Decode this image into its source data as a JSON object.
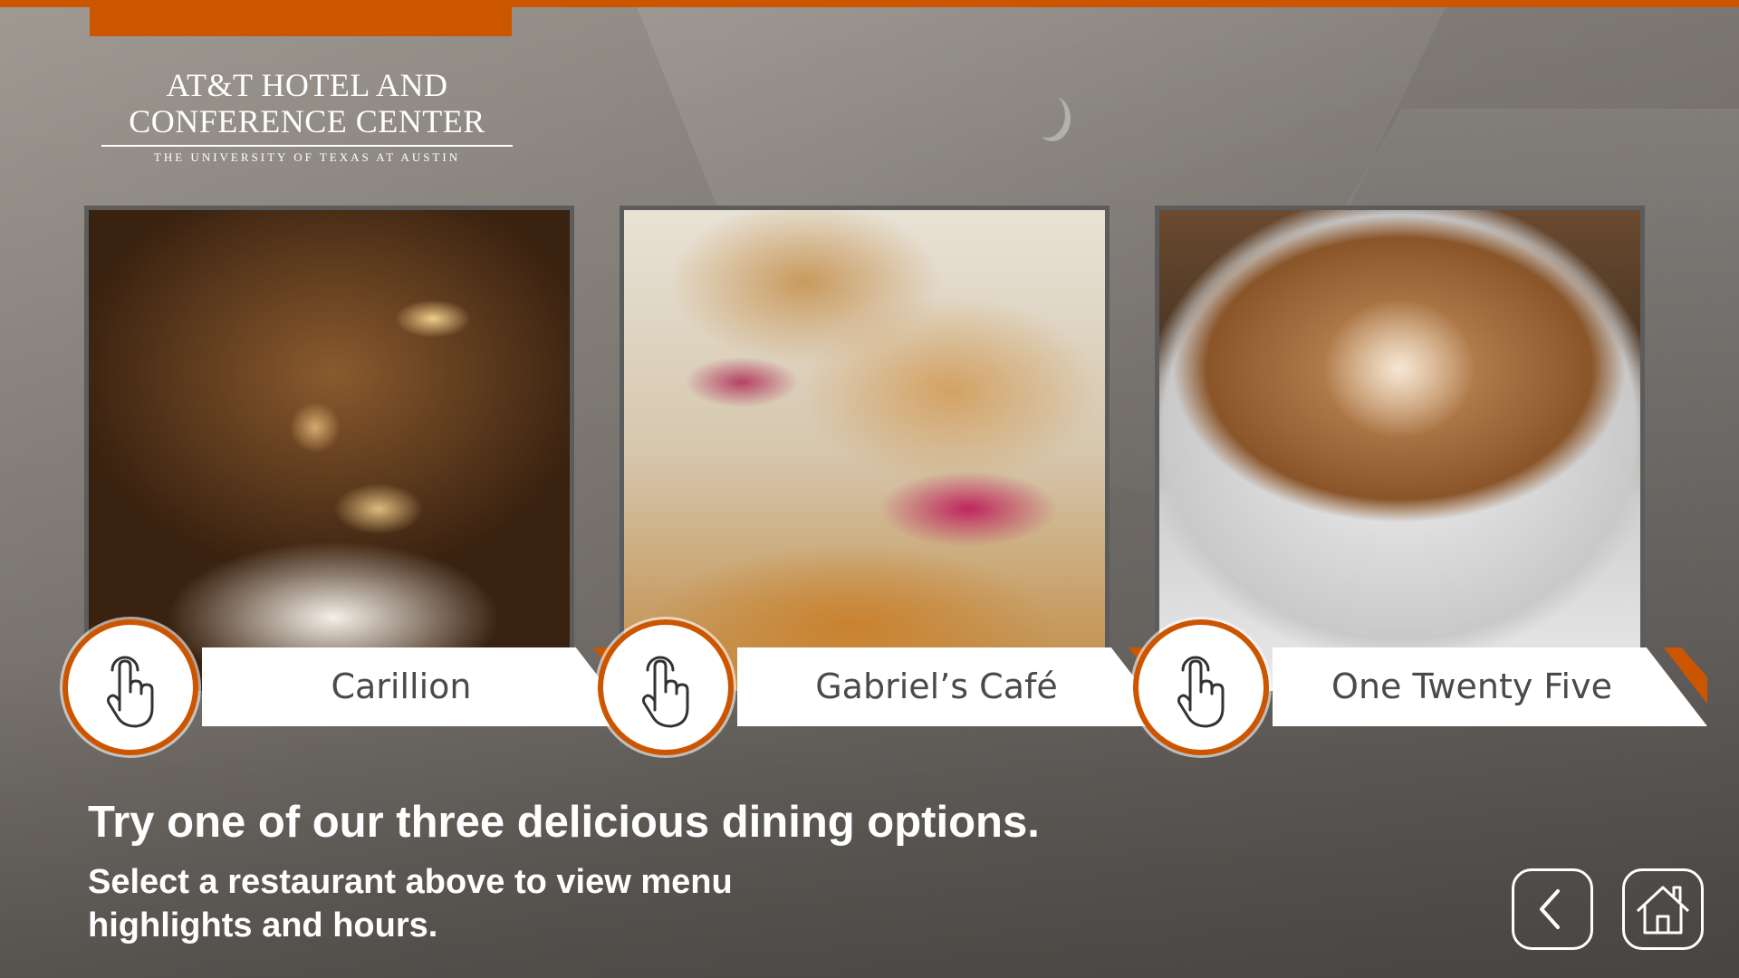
{
  "brand": {
    "line1": "AT&T HOTEL AND",
    "line2": "CONFERENCE CENTER",
    "tagline": "THE UNIVERSITY OF TEXAS AT AUSTIN"
  },
  "colors": {
    "accent": "#cc5500",
    "banner_text": "#4a4a4a",
    "text_light": "#ffffff"
  },
  "restaurants": [
    {
      "name": "Carillion",
      "icon": "tap-hand-icon"
    },
    {
      "name": "Gabriel’s Café",
      "icon": "tap-hand-icon"
    },
    {
      "name": "One Twenty Five",
      "icon": "tap-hand-icon"
    }
  ],
  "intro": {
    "headline": "Try one of our three delicious dining options.",
    "subline": "Select a restaurant above to view menu highlights and hours."
  },
  "nav": {
    "back_icon": "chevron-left-icon",
    "home_icon": "home-icon"
  }
}
